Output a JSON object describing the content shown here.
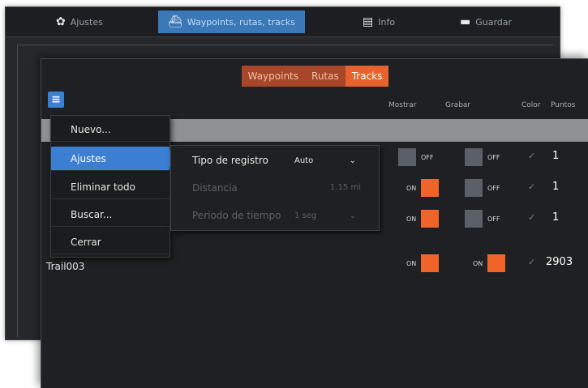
{
  "back_window": {
    "tabs": [
      {
        "label": "Ajustes",
        "icon": "gear-icon"
      },
      {
        "label": "Waypoints, rutas, tracks",
        "icon": "route-icon",
        "active": true
      },
      {
        "label": "Info",
        "icon": "info-icon"
      },
      {
        "label": "Guardar",
        "icon": "folder-icon"
      }
    ]
  },
  "front_window": {
    "tabs": [
      {
        "label": "Waypoints"
      },
      {
        "label": "Rutas"
      },
      {
        "label": "Tracks",
        "active": true
      }
    ],
    "columns": {
      "mostrar": "Mostrar",
      "grabar": "Grabar",
      "color": "Color",
      "puntos": "Puntos"
    },
    "rows": [
      {
        "name": "",
        "mostrar": "OFF",
        "grabar": "OFF",
        "puntos": "1"
      },
      {
        "name": "",
        "mostrar": "ON",
        "grabar": "OFF",
        "puntos": "1"
      },
      {
        "name": "",
        "mostrar": "ON",
        "grabar": "OFF",
        "puntos": "1"
      },
      {
        "name": "Trail003",
        "mostrar": "ON",
        "grabar": "ON",
        "puntos": "2903"
      }
    ]
  },
  "menu": {
    "items": [
      "Nuevo...",
      "Ajustes",
      "Eliminar todo",
      "Buscar...",
      "Cerrar"
    ],
    "selected_index": 1
  },
  "submenu": {
    "tipo_label": "Tipo de registro",
    "tipo_value": "Auto",
    "distancia_label": "Distancia",
    "distancia_value": "1.15 mi",
    "periodo_label": "Periodo de tiempo",
    "periodo_value": "1 seg"
  },
  "colors": {
    "accent_orange": "#e8622e",
    "accent_blue": "#3c7fd2",
    "on_color": "#f0642a",
    "off_color": "#5b6068"
  }
}
